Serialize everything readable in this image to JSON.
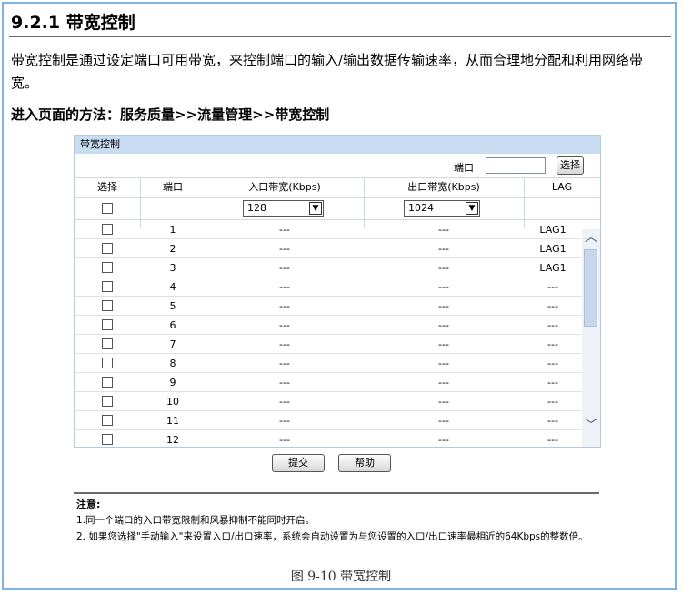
{
  "doc": {
    "heading": "9.2.1 带宽控制",
    "intro": "带宽控制是通过设定端口可用带宽，来控制端口的输入/输出数据传输速率，从而合理地分配和利用网络带宽。",
    "access": "进入页面的方法：服务质量>>流量管理>>带宽控制"
  },
  "panel": {
    "title": "带宽控制",
    "port_label": "端口",
    "port_value": "",
    "select_button": "选择",
    "columns": [
      "选择",
      "端口",
      "入口带宽(Kbps)",
      "出口带宽(Kbps)",
      "LAG"
    ],
    "ingress_select": "128",
    "egress_select": "1024",
    "rows": [
      {
        "port": "1",
        "ingress": "---",
        "egress": "---",
        "lag": "LAG1"
      },
      {
        "port": "2",
        "ingress": "---",
        "egress": "---",
        "lag": "LAG1"
      },
      {
        "port": "3",
        "ingress": "---",
        "egress": "---",
        "lag": "LAG1"
      },
      {
        "port": "4",
        "ingress": "---",
        "egress": "---",
        "lag": "---"
      },
      {
        "port": "5",
        "ingress": "---",
        "egress": "---",
        "lag": "---"
      },
      {
        "port": "6",
        "ingress": "---",
        "egress": "---",
        "lag": "---"
      },
      {
        "port": "7",
        "ingress": "---",
        "egress": "---",
        "lag": "---"
      },
      {
        "port": "8",
        "ingress": "---",
        "egress": "---",
        "lag": "---"
      },
      {
        "port": "9",
        "ingress": "---",
        "egress": "---",
        "lag": "---"
      },
      {
        "port": "10",
        "ingress": "---",
        "egress": "---",
        "lag": "---"
      },
      {
        "port": "11",
        "ingress": "---",
        "egress": "---",
        "lag": "---"
      },
      {
        "port": "12",
        "ingress": "---",
        "egress": "---",
        "lag": "---"
      }
    ],
    "submit_button": "提交",
    "help_button": "帮助"
  },
  "notes": {
    "title": "注意:",
    "items": [
      "1.同一个端口的入口带宽限制和风暴抑制不能同时开启。",
      "2. 如果您选择\"手动输入\"来设置入口/出口速率，系统会自动设置为与您设置的入口/出口速率最相近的64Kbps的整数倍。"
    ]
  },
  "caption": "图 9-10 带宽控制"
}
